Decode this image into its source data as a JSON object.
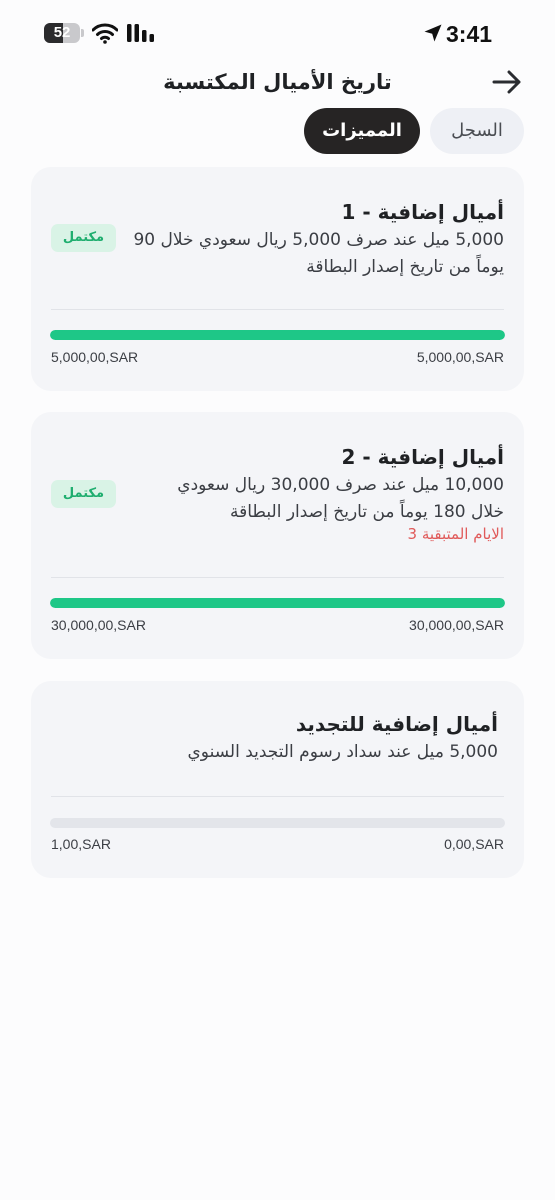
{
  "status_bar": {
    "battery": "52",
    "battery_level": 0.52,
    "time": "3:41",
    "icons": [
      "battery-icon",
      "wifi-icon",
      "cellular-signal-icon",
      "location-arrow-icon"
    ]
  },
  "header": {
    "title": "تاريخ الأميال المكتسبة",
    "back_icon": "arrow-icon"
  },
  "tabs": [
    {
      "label": "السجل",
      "active": false
    },
    {
      "label": "المميزات",
      "active": true
    }
  ],
  "cards": [
    {
      "title": "أميال إضافية - 1",
      "description": "5,000 ميل عند صرف 5,000 ريال سعودي خلال 90 يوماً من تاريخ إصدار البطاقة",
      "badge": "مكتمل",
      "progress": 1.0,
      "amount_left": "5,000,00,SAR",
      "amount_right": "5,000,00,SAR"
    },
    {
      "title": "أميال إضافية - 2",
      "description": "10,000 ميل عند صرف 30,000 ريال سعودي خلال 180 يوماً من تاريخ إصدار البطاقة",
      "remaining": "الايام المتبقية 3",
      "badge": "مكتمل",
      "progress": 1.0,
      "amount_left": "30,000,00,SAR",
      "amount_right": "30,000,00,SAR"
    },
    {
      "title": "أميال إضافية للتجديد",
      "description": "5,000 ميل عند سداد رسوم التجديد السنوي",
      "progress": 0.0,
      "amount_left": "1,00,SAR",
      "amount_right": "0,00,SAR"
    }
  ],
  "colors": {
    "accent_green": "#1ec787",
    "badge_bg": "#d9f3e6",
    "badge_text": "#1fae6f",
    "remaining_red": "#e05a5a",
    "active_tab_bg": "#262424",
    "card_bg": "#f4f5f8"
  }
}
